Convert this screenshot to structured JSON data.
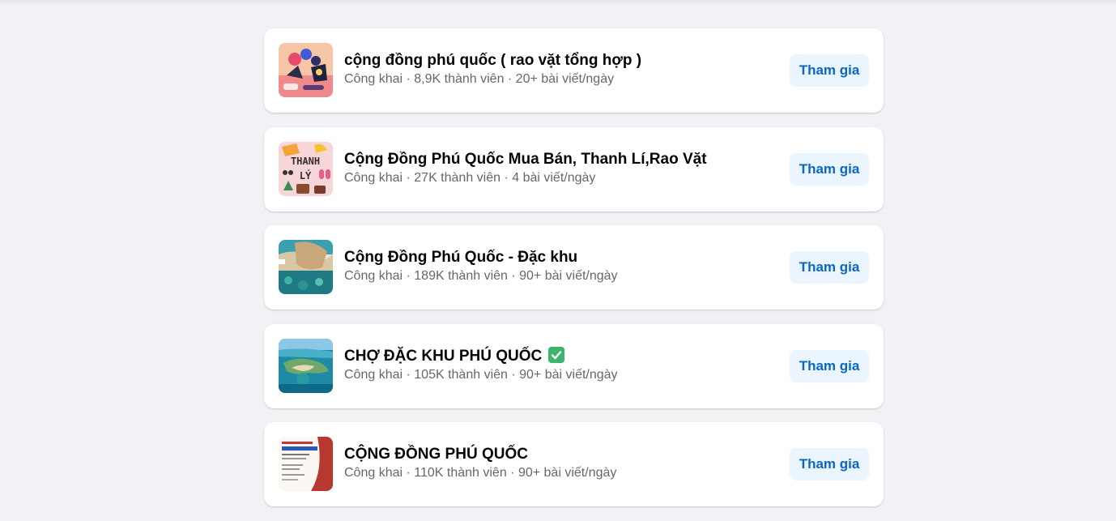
{
  "groups": [
    {
      "name": "cộng đồng phú quốc ( rao vặt tổng hợp )",
      "meta": "Công khai · 8,9K thành viên · 20+ bài viết/ngày",
      "join_label": "Tham gia",
      "thumbnail_icon": "group-cover-illustration-icon"
    },
    {
      "name": "Cộng Đồng Phú Quốc Mua Bán, Thanh Lí,Rao Vặt",
      "meta": "Công khai · 27K thành viên · 4 bài viết/ngày",
      "join_label": "Tham gia",
      "thumbnail_icon": "group-cover-thanh-ly-icon",
      "thumbnail_text": [
        "THANH",
        "LÝ"
      ]
    },
    {
      "name": "Cộng Đồng Phú Quốc - Đặc khu",
      "meta": "Công khai · 189K thành viên · 90+ bài viết/ngày",
      "join_label": "Tham gia",
      "thumbnail_icon": "group-cover-beach-icon"
    },
    {
      "name": "CHỢ ĐẶC KHU PHÚ QUỐC",
      "meta": "Công khai · 105K thành viên · 90+ bài viết/ngày",
      "join_label": "Tham gia",
      "thumbnail_icon": "group-cover-island-aerial-icon",
      "badge_icon": "check-mark-icon"
    },
    {
      "name": "CỘNG ĐỒNG PHÚ QUỐC",
      "meta": "Công khai · 110K thành viên · 90+ bài viết/ngày",
      "join_label": "Tham gia",
      "thumbnail_icon": "group-cover-poster-icon"
    }
  ],
  "colors": {
    "page_background": "#f0f2f5",
    "card_background": "#ffffff",
    "join_button_background": "#ebf5ff",
    "join_button_text": "#0a66c2",
    "meta_text": "#65676b",
    "verified_badge": "#3db46d"
  }
}
